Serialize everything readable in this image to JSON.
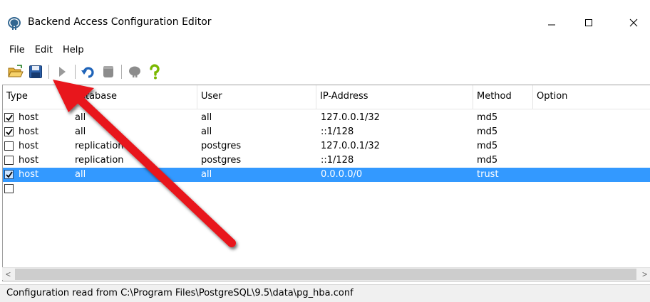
{
  "window": {
    "title": "Backend Access Configuration Editor",
    "controls": {
      "minimize": "—",
      "maximize": "☐",
      "close": "✕"
    }
  },
  "menu": {
    "items": [
      {
        "label": "File"
      },
      {
        "label": "Edit"
      },
      {
        "label": "Help"
      }
    ]
  },
  "toolbar": {
    "buttons": [
      {
        "name": "open-icon"
      },
      {
        "name": "save-icon"
      },
      {
        "name": "run-icon"
      },
      {
        "name": "undo-icon"
      },
      {
        "name": "delete-icon"
      },
      {
        "name": "hint-icon"
      },
      {
        "name": "help-icon"
      }
    ]
  },
  "table": {
    "columns": [
      "Type",
      "Database",
      "User",
      "IP-Address",
      "Method",
      "Option"
    ],
    "rows": [
      {
        "checked": true,
        "type": "host",
        "database": "all",
        "user": "all",
        "ip": "127.0.0.1/32",
        "method": "md5",
        "option": "",
        "selected": false
      },
      {
        "checked": true,
        "type": "host",
        "database": "all",
        "user": "all",
        "ip": "::1/128",
        "method": "md5",
        "option": "",
        "selected": false
      },
      {
        "checked": false,
        "type": "host",
        "database": "replication",
        "user": "postgres",
        "ip": "127.0.0.1/32",
        "method": "md5",
        "option": "",
        "selected": false
      },
      {
        "checked": false,
        "type": "host",
        "database": "replication",
        "user": "postgres",
        "ip": "::1/128",
        "method": "md5",
        "option": "",
        "selected": false
      },
      {
        "checked": true,
        "type": "host",
        "database": "all",
        "user": "all",
        "ip": "0.0.0.0/0",
        "method": "trust",
        "option": "",
        "selected": true
      },
      {
        "checked": false,
        "type": "",
        "database": "",
        "user": "",
        "ip": "",
        "method": "",
        "option": "",
        "selected": false
      }
    ]
  },
  "scrollbar": {
    "left_arrow": "<",
    "right_arrow": ">"
  },
  "status": {
    "text": "Configuration read from C:\\Program Files\\PostgreSQL\\9.5\\data\\pg_hba.conf"
  },
  "colors": {
    "selection": "#3399ff",
    "annotation_arrow": "#e8141b"
  }
}
